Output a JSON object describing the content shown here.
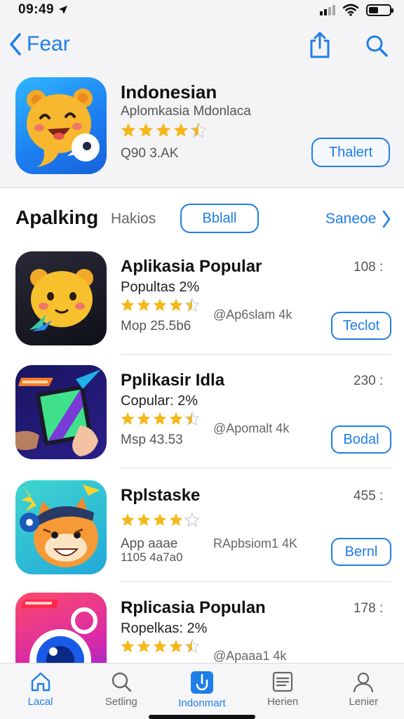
{
  "status_bar": {
    "time": "09:49"
  },
  "nav": {
    "back_label": "Fear"
  },
  "hero": {
    "title": "Indonesian",
    "subtitle": "Aplomkasia Mdonlaca",
    "rating": 4.5,
    "meta": "Q90 3.AK",
    "button_label": "Thalert"
  },
  "section": {
    "title": "Apalking",
    "tab_label": "Hakios",
    "pill_label": "Bblall",
    "see_all_label": "Saneoe"
  },
  "apps": [
    {
      "name": "Aplikasia Popular",
      "subtitle": "Popultas 2%",
      "rating": 4.5,
      "meta": "Mop 25.5b6",
      "developer": "@Ap6slam 4k",
      "rank": "108 :",
      "button_label": "Teclot"
    },
    {
      "name": "Pplikasir Idla",
      "subtitle": "Copular: 2%",
      "rating": 4.5,
      "meta": "Msp 43.53",
      "developer": "@Apomalt 4k",
      "rank": "230 :",
      "button_label": "Bodal"
    },
    {
      "name": "Rplstaske",
      "subtitle": "",
      "rating": 4.0,
      "meta": "App aaae",
      "meta2": "1105 4a7a0",
      "developer": "RApbsiom1 4K",
      "rank": "455 :",
      "button_label": "Bernl"
    },
    {
      "name": "Rplicasia Populan",
      "subtitle": "Ropelkas: 2%",
      "rating": 4.5,
      "meta": "",
      "developer": "@Apaaa1 4k",
      "rank": "178 :",
      "button_label": ""
    }
  ],
  "tabs": [
    {
      "label": "Lacal",
      "icon": "home-icon"
    },
    {
      "label": "Setling",
      "icon": "search-icon"
    },
    {
      "label": "Indonmart",
      "icon": "apps-icon",
      "active": true
    },
    {
      "label": "Herien",
      "icon": "list-icon"
    },
    {
      "label": "Lenier",
      "icon": "person-icon"
    }
  ],
  "colors": {
    "accent": "#1f7ee8",
    "star": "#f5b81c",
    "background": "#f4f4f6"
  }
}
